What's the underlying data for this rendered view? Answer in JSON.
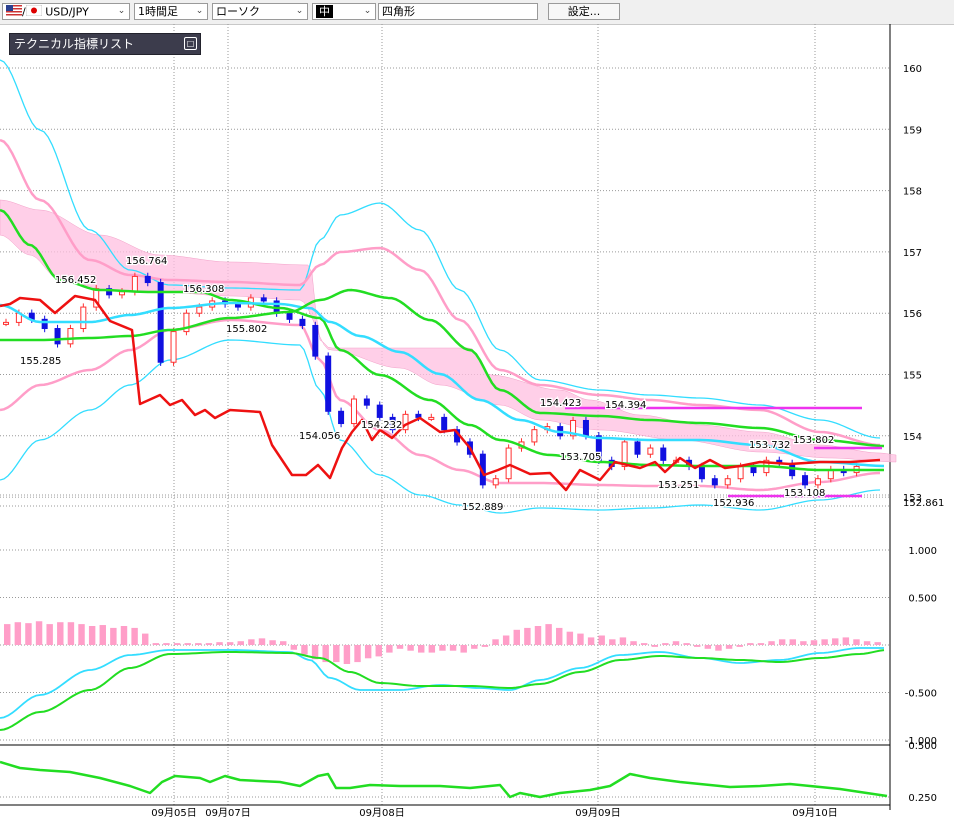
{
  "toolbar": {
    "symbol": "USD/JPY",
    "timeframe": "1時間足",
    "chart_type": "ローソク",
    "line_width": "中",
    "drawing_tool": "四角形",
    "settings_button": "設定..."
  },
  "tech_list_label": "テクニカル指標リスト",
  "colors": {
    "bull_candle": "#ff3030",
    "bear_candle": "#1010e0",
    "red_line": "#ee1111",
    "green": "#22dd22",
    "cyan": "#33ddff",
    "pink": "#ff9ec8",
    "cloud": "#ffbfe0",
    "magenta": "#ee33ee"
  },
  "chart_data": [
    {
      "type": "line",
      "name": "price",
      "y_ticks": [
        "160",
        "159",
        "158",
        "157",
        "156",
        "155",
        "154",
        "153"
      ],
      "current_price": "152.861",
      "annotations": [
        "156.452",
        "156.764",
        "156.308",
        "155.802",
        "155.285",
        "154.056",
        "154.232",
        "154.423",
        "154.394",
        "153.705",
        "153.251",
        "152.889",
        "152.936",
        "153.732",
        "153.802",
        "153.108"
      ],
      "x_ticks": [
        "09月05日",
        "09月07日",
        "09月08日",
        "09月09日",
        "09月10日"
      ],
      "series": [
        {
          "values": [
            155.85,
            156.0,
            155.9,
            155.75,
            155.5,
            155.75,
            156.1,
            156.4,
            156.3,
            156.35,
            156.6,
            156.5,
            155.2,
            155.7,
            156.0,
            156.1,
            156.2,
            156.15,
            156.1,
            156.25,
            156.2,
            156.0,
            155.9,
            155.8,
            155.3,
            154.4,
            154.2,
            154.6,
            154.5,
            154.3,
            154.1,
            154.35,
            154.3,
            154.3,
            154.1,
            153.9,
            153.7,
            153.2,
            153.3,
            153.8,
            153.9,
            154.1,
            154.15,
            154.0,
            154.25,
            154.0,
            153.6,
            153.5,
            153.9,
            153.7,
            153.8,
            153.6,
            153.6,
            153.5,
            153.3,
            153.2,
            153.3,
            153.5,
            153.4,
            153.6,
            153.55,
            153.35,
            153.2,
            153.3,
            153.45,
            153.4,
            153.5
          ]
        }
      ]
    },
    {
      "type": "bar",
      "name": "macd",
      "y_ticks": [
        "1.000",
        "0.500",
        "-0.500",
        "-1.000"
      ]
    },
    {
      "type": "line",
      "name": "oscillator",
      "y_ticks": [
        "0.500",
        "0.250"
      ]
    }
  ]
}
